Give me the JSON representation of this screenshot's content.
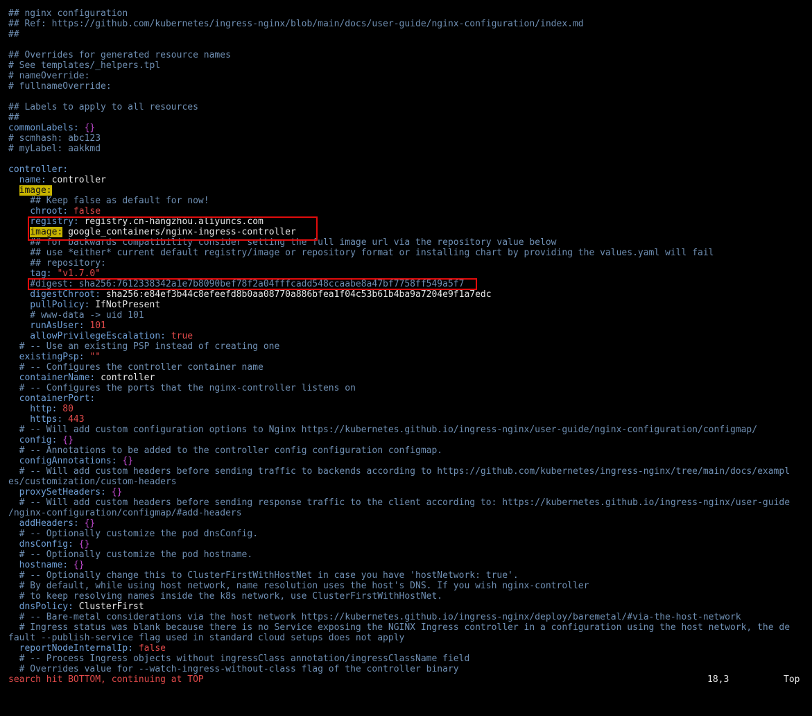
{
  "buffer": {
    "lines": [
      [
        {
          "c": "cm",
          "t": "## nginx configuration"
        }
      ],
      [
        {
          "c": "cm",
          "t": "## Ref: https://github.com/kubernetes/ingress-nginx/blob/main/docs/user-guide/nginx-configuration/index.md"
        }
      ],
      [
        {
          "c": "cm",
          "t": "##"
        }
      ],
      [],
      [
        {
          "c": "cm",
          "t": "## Overrides for generated resource names"
        }
      ],
      [
        {
          "c": "cm",
          "t": "# See templates/_helpers.tpl"
        }
      ],
      [
        {
          "c": "cm",
          "t": "# nameOverride:"
        }
      ],
      [
        {
          "c": "cm",
          "t": "# fullnameOverride:"
        }
      ],
      [],
      [
        {
          "c": "cm",
          "t": "## Labels to apply to all resources"
        }
      ],
      [
        {
          "c": "cm",
          "t": "##"
        }
      ],
      [
        {
          "c": "key",
          "t": "commonLabels"
        },
        {
          "c": "key",
          "t": ": "
        },
        {
          "c": "sym",
          "t": "{}"
        }
      ],
      [
        {
          "c": "cm",
          "t": "# scmhash: abc123"
        }
      ],
      [
        {
          "c": "cm",
          "t": "# myLabel: aakkmd"
        }
      ],
      [],
      [
        {
          "c": "key",
          "t": "controller:"
        }
      ],
      [
        {
          "c": "key",
          "t": "  name: "
        },
        {
          "c": "txt",
          "t": "controller"
        }
      ],
      [
        {
          "c": "txt",
          "t": "  "
        },
        {
          "c": "hl",
          "t": "image:"
        }
      ],
      [
        {
          "c": "cm",
          "t": "    ## Keep false as default for now!"
        }
      ],
      [
        {
          "c": "key",
          "t": "    chroot: "
        },
        {
          "c": "num",
          "t": "false"
        }
      ],
      [
        {
          "c": "key",
          "t": "    registry: "
        },
        {
          "c": "txt",
          "t": "registry.cn-hangzhou.aliyuncs.com"
        }
      ],
      [
        {
          "c": "txt",
          "t": "    "
        },
        {
          "c": "hl",
          "t": "image:"
        },
        {
          "c": "txt",
          "t": " google_containers/nginx-ingress-controller"
        }
      ],
      [
        {
          "c": "cm",
          "t": "    ## for backwards compatibility consider setting the full image url via the repository value below"
        }
      ],
      [
        {
          "c": "cm",
          "t": "    ## use *either* current default registry/image or repository format or installing chart by providing the values.yaml will fail"
        }
      ],
      [
        {
          "c": "cm",
          "t": "    ## repository:"
        }
      ],
      [
        {
          "c": "key",
          "t": "    tag: "
        },
        {
          "c": "num",
          "t": "\"v1.7.0\""
        }
      ],
      [
        {
          "c": "cm",
          "t": "    #digest: sha256:7612338342a1e7b8090bef78f2a04fffcadd548ccaabe8a47bf7758ff549a5f7"
        }
      ],
      [
        {
          "c": "key",
          "t": "    digestChroot: "
        },
        {
          "c": "txt",
          "t": "sha256:e84ef3b44c8efeefd8b0aa08770a886bfea1f04c53b61b4ba9a7204e9f1a7edc"
        }
      ],
      [
        {
          "c": "key",
          "t": "    pullPolicy: "
        },
        {
          "c": "txt",
          "t": "IfNotPresent"
        }
      ],
      [
        {
          "c": "cm",
          "t": "    # www-data -> uid 101"
        }
      ],
      [
        {
          "c": "key",
          "t": "    runAsUser: "
        },
        {
          "c": "num",
          "t": "101"
        }
      ],
      [
        {
          "c": "key",
          "t": "    allowPrivilegeEscalation: "
        },
        {
          "c": "num",
          "t": "true"
        }
      ],
      [
        {
          "c": "cm",
          "t": "  # -- Use an existing PSP instead of creating one"
        }
      ],
      [
        {
          "c": "key",
          "t": "  existingPsp: "
        },
        {
          "c": "num",
          "t": "\"\""
        }
      ],
      [
        {
          "c": "cm",
          "t": "  # -- Configures the controller container name"
        }
      ],
      [
        {
          "c": "key",
          "t": "  containerName: "
        },
        {
          "c": "txt",
          "t": "controller"
        }
      ],
      [
        {
          "c": "cm",
          "t": "  # -- Configures the ports that the nginx-controller listens on"
        }
      ],
      [
        {
          "c": "key",
          "t": "  containerPort:"
        }
      ],
      [
        {
          "c": "key",
          "t": "    http: "
        },
        {
          "c": "num",
          "t": "80"
        }
      ],
      [
        {
          "c": "key",
          "t": "    https: "
        },
        {
          "c": "num",
          "t": "443"
        }
      ],
      [
        {
          "c": "cm",
          "t": "  # -- Will add custom configuration options to Nginx https://kubernetes.github.io/ingress-nginx/user-guide/nginx-configuration/configmap/"
        }
      ],
      [
        {
          "c": "key",
          "t": "  config: "
        },
        {
          "c": "sym",
          "t": "{}"
        }
      ],
      [
        {
          "c": "cm",
          "t": "  # -- Annotations to be added to the controller config configuration configmap."
        }
      ],
      [
        {
          "c": "key",
          "t": "  configAnnotations: "
        },
        {
          "c": "sym",
          "t": "{}"
        }
      ],
      [
        {
          "c": "cm",
          "t": "  # -- Will add custom headers before sending traffic to backends according to https://github.com/kubernetes/ingress-nginx/tree/main/docs/exampl"
        }
      ],
      [
        {
          "c": "cm",
          "t": "es/customization/custom-headers"
        }
      ],
      [
        {
          "c": "key",
          "t": "  proxySetHeaders: "
        },
        {
          "c": "sym",
          "t": "{}"
        }
      ],
      [
        {
          "c": "cm",
          "t": "  # -- Will add custom headers before sending response traffic to the client according to: https://kubernetes.github.io/ingress-nginx/user-guide"
        }
      ],
      [
        {
          "c": "cm",
          "t": "/nginx-configuration/configmap/#add-headers"
        }
      ],
      [
        {
          "c": "key",
          "t": "  addHeaders: "
        },
        {
          "c": "sym",
          "t": "{}"
        }
      ],
      [
        {
          "c": "cm",
          "t": "  # -- Optionally customize the pod dnsConfig."
        }
      ],
      [
        {
          "c": "key",
          "t": "  dnsConfig: "
        },
        {
          "c": "sym",
          "t": "{}"
        }
      ],
      [
        {
          "c": "cm",
          "t": "  # -- Optionally customize the pod hostname."
        }
      ],
      [
        {
          "c": "key",
          "t": "  hostname: "
        },
        {
          "c": "sym",
          "t": "{}"
        }
      ],
      [
        {
          "c": "cm",
          "t": "  # -- Optionally change this to ClusterFirstWithHostNet in case you have 'hostNetwork: true'."
        }
      ],
      [
        {
          "c": "cm",
          "t": "  # By default, while using host network, name resolution uses the host's DNS. If you wish nginx-controller"
        }
      ],
      [
        {
          "c": "cm",
          "t": "  # to keep resolving names inside the k8s network, use ClusterFirstWithHostNet."
        }
      ],
      [
        {
          "c": "key",
          "t": "  dnsPolicy: "
        },
        {
          "c": "txt",
          "t": "ClusterFirst"
        }
      ],
      [
        {
          "c": "cm",
          "t": "  # -- Bare-metal considerations via the host network https://kubernetes.github.io/ingress-nginx/deploy/baremetal/#via-the-host-network"
        }
      ],
      [
        {
          "c": "cm",
          "t": "  # Ingress status was blank because there is no Service exposing the NGINX Ingress controller in a configuration using the host network, the de"
        }
      ],
      [
        {
          "c": "cm",
          "t": "fault --publish-service flag used in standard cloud setups does not apply"
        }
      ],
      [
        {
          "c": "key",
          "t": "  reportNodeInternalIp: "
        },
        {
          "c": "num",
          "t": "false"
        }
      ],
      [
        {
          "c": "cm",
          "t": "  # -- Process Ingress objects without ingressClass annotation/ingressClassName field"
        }
      ],
      [
        {
          "c": "cm",
          "t": "  # Overrides value for --watch-ingress-without-class flag of the controller binary"
        }
      ]
    ]
  },
  "statusbar": {
    "message": "search hit BOTTOM, continuing at TOP",
    "position": "18,3",
    "scroll": "Top"
  },
  "colors": {
    "background": "#000000",
    "comment": "#6f8fb3",
    "key": "#6f9fd6",
    "string_number": "#e04a4a",
    "braces": "#c14ad0",
    "search_highlight": "#c8b400",
    "annotation_box": "#e10c0c"
  }
}
